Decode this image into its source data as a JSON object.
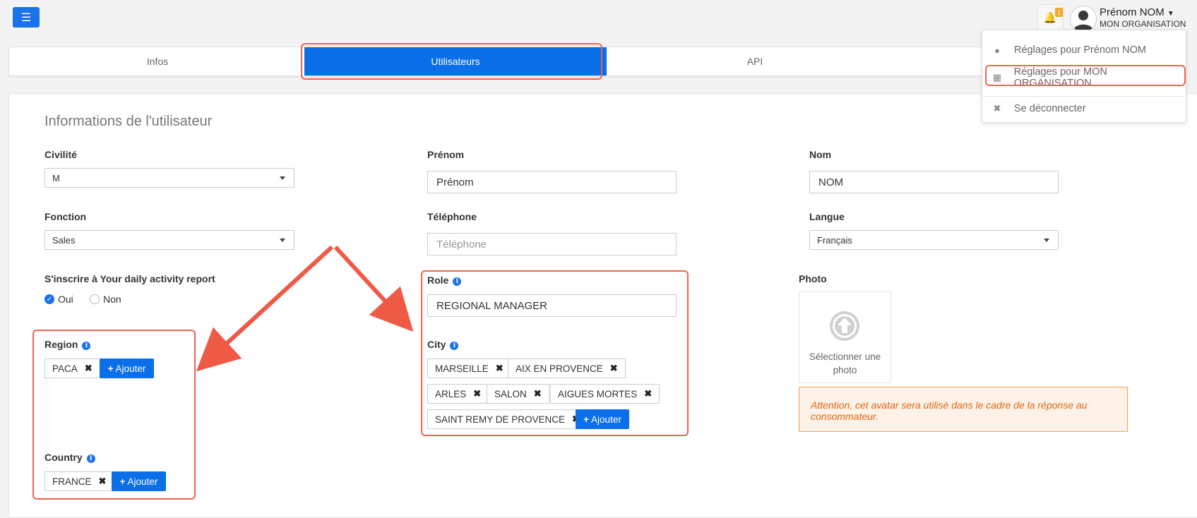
{
  "header": {
    "user_name": "Prénom NOM",
    "user_org": "MON ORGANISATION",
    "notification_count": "1"
  },
  "tabs": [
    {
      "label": "Infos",
      "active": false
    },
    {
      "label": "Utilisateurs",
      "active": true
    },
    {
      "label": "API",
      "active": false
    }
  ],
  "user_menu": {
    "items": [
      {
        "label": "Réglages pour Prénom NOM",
        "icon": "user-icon"
      },
      {
        "label": "Réglages pour MON ORGANISATION",
        "icon": "building-icon"
      },
      {
        "label": "Se déconnecter",
        "icon": "close-icon"
      }
    ]
  },
  "form": {
    "section_title": "Informations de l'utilisateur",
    "civilite": {
      "label": "Civilité",
      "value": "M"
    },
    "prenom": {
      "label": "Prénom",
      "value": "Prénom"
    },
    "nom": {
      "label": "Nom",
      "value": "NOM"
    },
    "fonction": {
      "label": "Fonction",
      "value": "Sales"
    },
    "telephone": {
      "label": "Téléphone",
      "placeholder": "Téléphone"
    },
    "langue": {
      "label": "Langue",
      "value": "Français"
    },
    "subscribe": {
      "label": "S'inscrire à Your daily activity report",
      "yes": "Oui",
      "no": "Non",
      "selected": "Oui"
    },
    "role": {
      "label": "Role",
      "value": "REGIONAL MANAGER"
    },
    "photo": {
      "label": "Photo",
      "upload_text": "Sélectionner une photo"
    },
    "region": {
      "label": "Region",
      "tags": [
        "PACA"
      ]
    },
    "country": {
      "label": "Country",
      "tags": [
        "FRANCE"
      ]
    },
    "city": {
      "label": "City",
      "tags": [
        "MARSEILLE",
        "AIX EN PROVENCE",
        "ARLES",
        "SALON",
        "AIGUES MORTES",
        "SAINT REMY DE PROVENCE"
      ]
    },
    "add_label": "Ajouter",
    "warning": "Attention, cet avatar sera utilisé dans le cadre de la réponse au consommateur."
  },
  "colors": {
    "primary": "#0a6fe8",
    "highlight": "#ef6352",
    "warning_text": "#e0660f",
    "warning_bg": "#fef2e8"
  }
}
